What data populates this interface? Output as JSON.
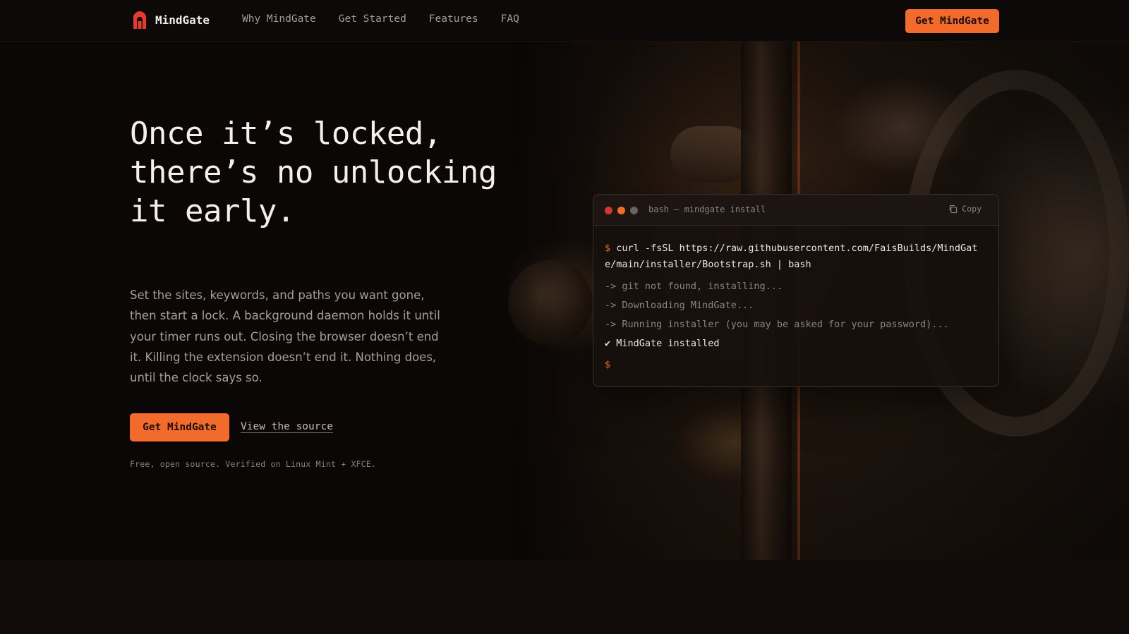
{
  "nav": {
    "brand": "MindGate",
    "links": [
      "Why MindGate",
      "Get Started",
      "Features",
      "FAQ"
    ],
    "cta_label": "Get MindGate"
  },
  "colors": {
    "accent": "#f36b2a",
    "logo_red": "#e83a2b",
    "background": "#0a0706"
  },
  "hero": {
    "headline": "Once it’s locked, there’s no unlocking it early.",
    "lead": "Set the sites, keywords, and paths you want gone, then start a lock. A background daemon holds it until your timer runs out. Closing the browser doesn’t end it. Killing the extension doesn’t end it. Nothing does, until the clock says so.",
    "primary_cta": "Get MindGate",
    "secondary_link": "View the source",
    "fineprint": "Free, open source. Verified on Linux Mint + XFCE."
  },
  "terminal": {
    "title": "bash — mindgate install",
    "copy_label": "Copy",
    "prompt": "$",
    "command": "curl -fsSL https://raw.githubusercontent.com/FaisBuilds/MindGate/main/installer/Bootstrap.sh | bash",
    "output": [
      "-> git not found, installing...",
      "-> Downloading MindGate...",
      "-> Running installer (you may be asked for your password)..."
    ],
    "success": "✔ MindGate installed"
  },
  "icons": {
    "logo": "lock-gate-icon",
    "copy": "copy-icon"
  }
}
